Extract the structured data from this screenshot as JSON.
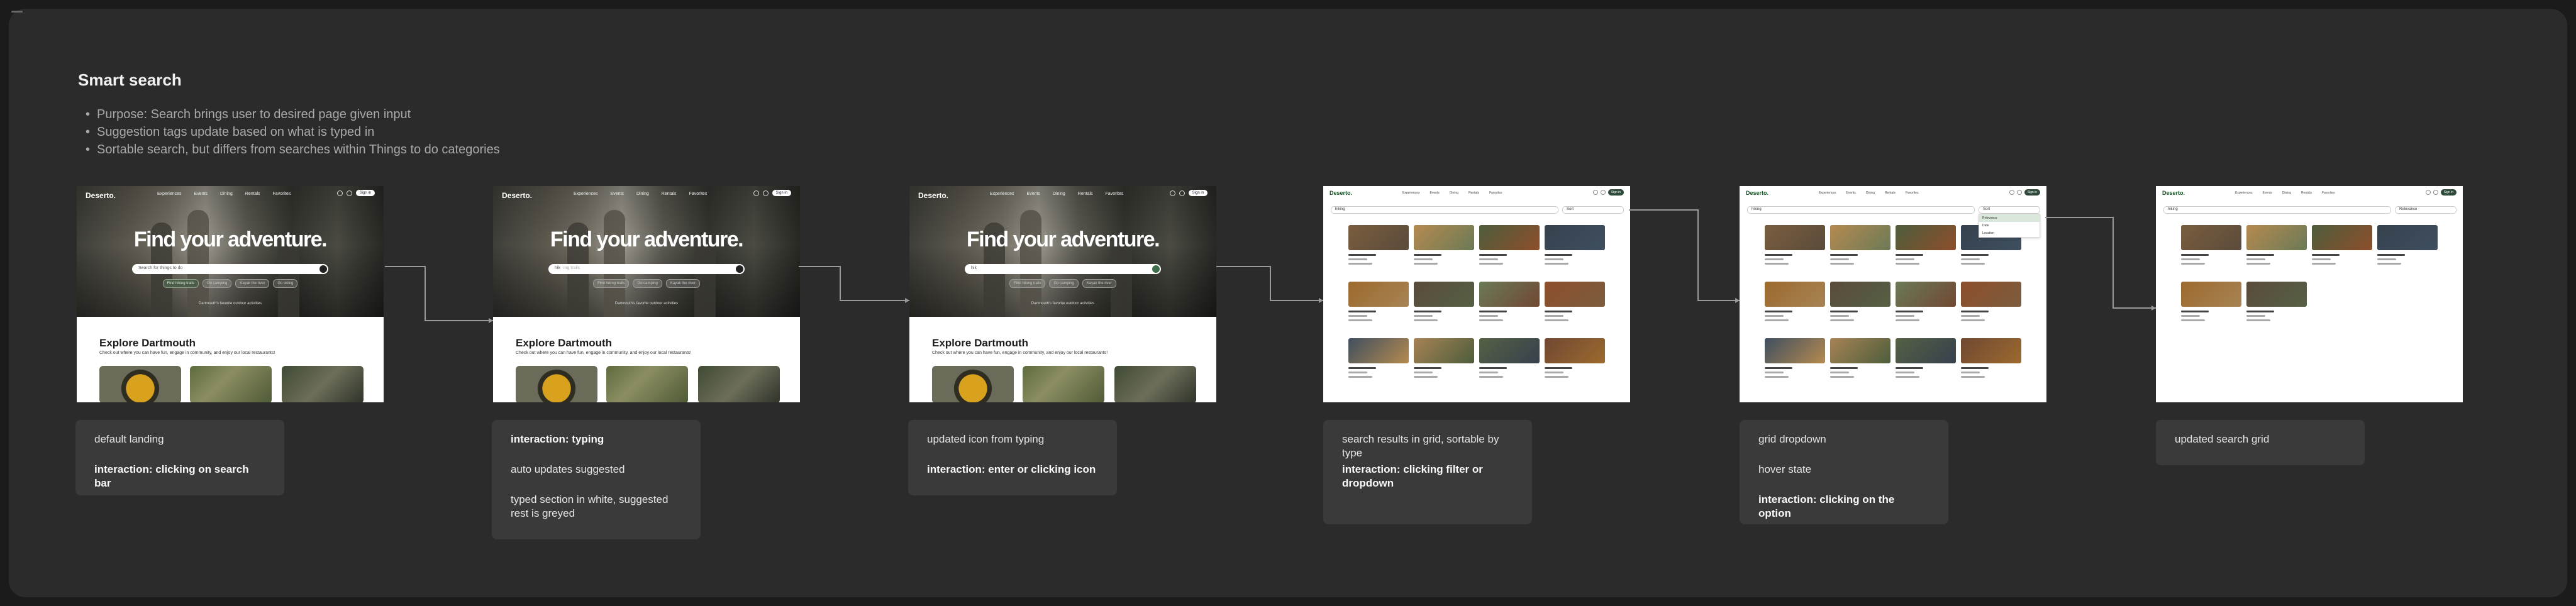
{
  "board": {
    "title": "Smart search",
    "bullets": [
      "Purpose: Search brings user to desired page given input",
      "Suggestion tags update based on what is typed in",
      "Sortable search, but differs from searches within Things to do categories"
    ]
  },
  "landing": {
    "brand": "Deserto.",
    "nav": [
      "Experiences",
      "Events",
      "Dining",
      "Rentals",
      "Favorites"
    ],
    "heading": "Find your adventure.",
    "search_placeholder": "Search for things to do",
    "typed_text": "hik",
    "suggestion_completion": "ing trails",
    "tags": [
      "Find hiking trails",
      "Go camping",
      "Kayak the river",
      "Go skiing"
    ],
    "subtitle": "Dartmouth's favorite outdoor activities",
    "explore_heading": "Explore Dartmouth",
    "explore_sub": "Check out where you can have fun, engage in community, and enjoy our local restaurants!",
    "signin": "Sign in"
  },
  "results": {
    "brand": "Deserto.",
    "nav": [
      "Experiences",
      "Events",
      "Dining",
      "Rentals",
      "Favorites"
    ],
    "query": "hiking",
    "sort_label": "Sort",
    "sort_options": [
      "Relevance",
      "Date",
      "Location"
    ],
    "signin": "Sign in"
  },
  "callouts": [
    {
      "lines": [
        {
          "text": "default landing",
          "bold": false
        },
        {
          "text": "interaction: clicking on search bar",
          "bold": true
        }
      ]
    },
    {
      "lines": [
        {
          "text": "interaction: typing",
          "bold": true
        },
        {
          "text": "auto updates suggested",
          "bold": false
        },
        {
          "text": "typed section in white, suggested rest is greyed",
          "bold": false
        }
      ]
    },
    {
      "lines": [
        {
          "text": "updated icon from typing",
          "bold": false
        },
        {
          "text": "interaction: enter or clicking icon",
          "bold": true
        }
      ]
    },
    {
      "lines": [
        {
          "text": "search results in grid, sortable by type",
          "bold": false
        },
        {
          "text": "interaction: clicking filter or dropdown",
          "bold": true
        }
      ]
    },
    {
      "lines": [
        {
          "text": "grid dropdown",
          "bold": false
        },
        {
          "text": "hover state",
          "bold": false
        },
        {
          "text": "interaction: clicking on the option",
          "bold": true
        }
      ]
    },
    {
      "lines": [
        {
          "text": "updated search grid",
          "bold": false
        }
      ]
    }
  ]
}
